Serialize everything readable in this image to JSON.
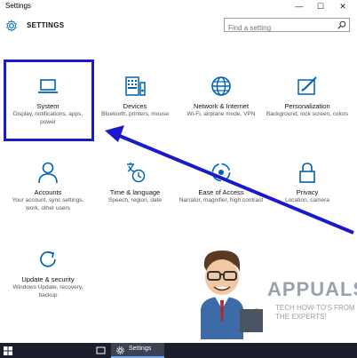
{
  "window": {
    "title": "Settings"
  },
  "window_controls": {
    "minimize": "—",
    "maximize": "☐",
    "close": "✕"
  },
  "header": {
    "title": "SETTINGS",
    "search_placeholder": "Find a setting"
  },
  "tiles": [
    {
      "id": "system",
      "name": "System",
      "desc": "Display, notifications, apps, power",
      "icon": "laptop-icon"
    },
    {
      "id": "devices",
      "name": "Devices",
      "desc": "Bluetooth, printers, mouse",
      "icon": "keyboard-speaker-icon"
    },
    {
      "id": "network",
      "name": "Network & Internet",
      "desc": "Wi-Fi, airplane mode, VPN",
      "icon": "globe-icon"
    },
    {
      "id": "personalization",
      "name": "Personalization",
      "desc": "Background, lock screen, colors",
      "icon": "paint-icon"
    },
    {
      "id": "accounts",
      "name": "Accounts",
      "desc": "Your account, sync settings, work, other users",
      "icon": "person-icon"
    },
    {
      "id": "time",
      "name": "Time & language",
      "desc": "Speech, region, date",
      "icon": "language-clock-icon"
    },
    {
      "id": "ease",
      "name": "Ease of Access",
      "desc": "Narrator, magnifier, high contrast",
      "icon": "ease-of-access-icon"
    },
    {
      "id": "privacy",
      "name": "Privacy",
      "desc": "Location, camera",
      "icon": "lock-icon"
    },
    {
      "id": "update",
      "name": "Update & security",
      "desc": "Windows Update, recovery, backup",
      "icon": "refresh-icon"
    }
  ],
  "watermark": {
    "brand": "APPUALS",
    "tagline_1": "TECH HOW-TO'S FROM",
    "tagline_2": "THE EXPERTS!"
  },
  "taskbar": {
    "app_label": "Settings"
  },
  "colors": {
    "accent": "#0063b1",
    "highlight": "#1a1acc",
    "taskbar": "#1b1f2b"
  }
}
